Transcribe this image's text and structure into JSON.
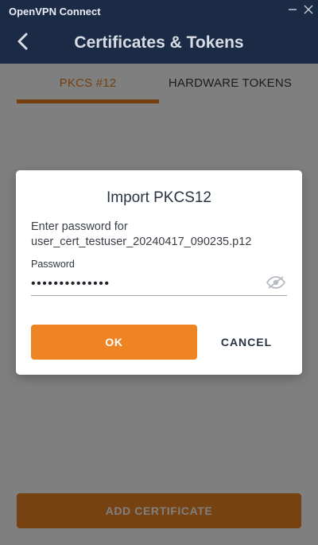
{
  "window": {
    "title": "OpenVPN Connect",
    "minimize_icon": "minimize-icon",
    "close_icon": "close-icon"
  },
  "header": {
    "title": "Certificates & Tokens",
    "back_icon": "chevron-left-icon"
  },
  "tabs": [
    {
      "label": "PKCS #12",
      "active": true
    },
    {
      "label": "HARDWARE TOKENS",
      "active": false
    }
  ],
  "footer": {
    "add_certificate_label": "ADD CERTIFICATE"
  },
  "dialog": {
    "title": "Import PKCS12",
    "message_line1": "Enter password for",
    "message_line2": "user_cert_testuser_20240417_090235.p12",
    "password_label": "Password",
    "password_value": "••••••••••••••",
    "visibility_icon": "eye-off-icon",
    "ok_label": "OK",
    "cancel_label": "CANCEL"
  },
  "colors": {
    "brand_navy": "#1b2b45",
    "accent_orange": "#ef8424"
  }
}
